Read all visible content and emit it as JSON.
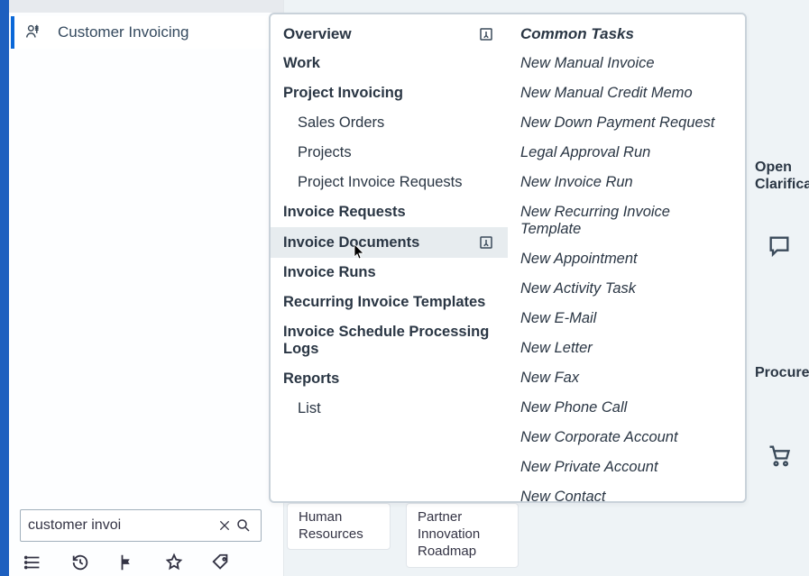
{
  "sidebar": {
    "active_item": {
      "label": "Customer Invoicing",
      "icon": "invoice-person-icon"
    },
    "search": {
      "value": "customer invoi",
      "placeholder": "Search"
    }
  },
  "flyout": {
    "left_col": {
      "header": "Overview",
      "items": [
        {
          "label": "Work",
          "kind": "section"
        },
        {
          "label": "Project Invoicing",
          "kind": "section"
        },
        {
          "label": "Sales Orders",
          "kind": "sub"
        },
        {
          "label": "Projects",
          "kind": "sub"
        },
        {
          "label": "Project Invoice Requests",
          "kind": "sub"
        },
        {
          "label": "Invoice Requests",
          "kind": "section"
        },
        {
          "label": "Invoice Documents",
          "kind": "section",
          "hovered": true
        },
        {
          "label": "Invoice Runs",
          "kind": "section"
        },
        {
          "label": "Recurring Invoice Templates",
          "kind": "section"
        },
        {
          "label": "Invoice Schedule Processing Logs",
          "kind": "section"
        },
        {
          "label": "Reports",
          "kind": "section"
        },
        {
          "label": "List",
          "kind": "sub"
        }
      ]
    },
    "right_col": {
      "header": "Common Tasks",
      "items": [
        {
          "label": "New Manual Invoice"
        },
        {
          "label": "New Manual Credit Memo"
        },
        {
          "label": "New Down Payment Request"
        },
        {
          "label": "Legal Approval Run"
        },
        {
          "label": "New Invoice Run"
        },
        {
          "label": "New Recurring Invoice Template"
        },
        {
          "label": "New Appointment"
        },
        {
          "label": "New Activity Task"
        },
        {
          "label": "New E-Mail"
        },
        {
          "label": "New Letter"
        },
        {
          "label": "New Fax"
        },
        {
          "label": "New Phone Call"
        },
        {
          "label": "New Corporate Account"
        },
        {
          "label": "New Private Account"
        },
        {
          "label": "New Contact"
        }
      ]
    }
  },
  "bg_tiles": {
    "hr": "Human Resources",
    "partner": "Partner Innovation Roadmap"
  },
  "right_rail": {
    "label1": "Open Clarifica",
    "label2": "Procure"
  }
}
